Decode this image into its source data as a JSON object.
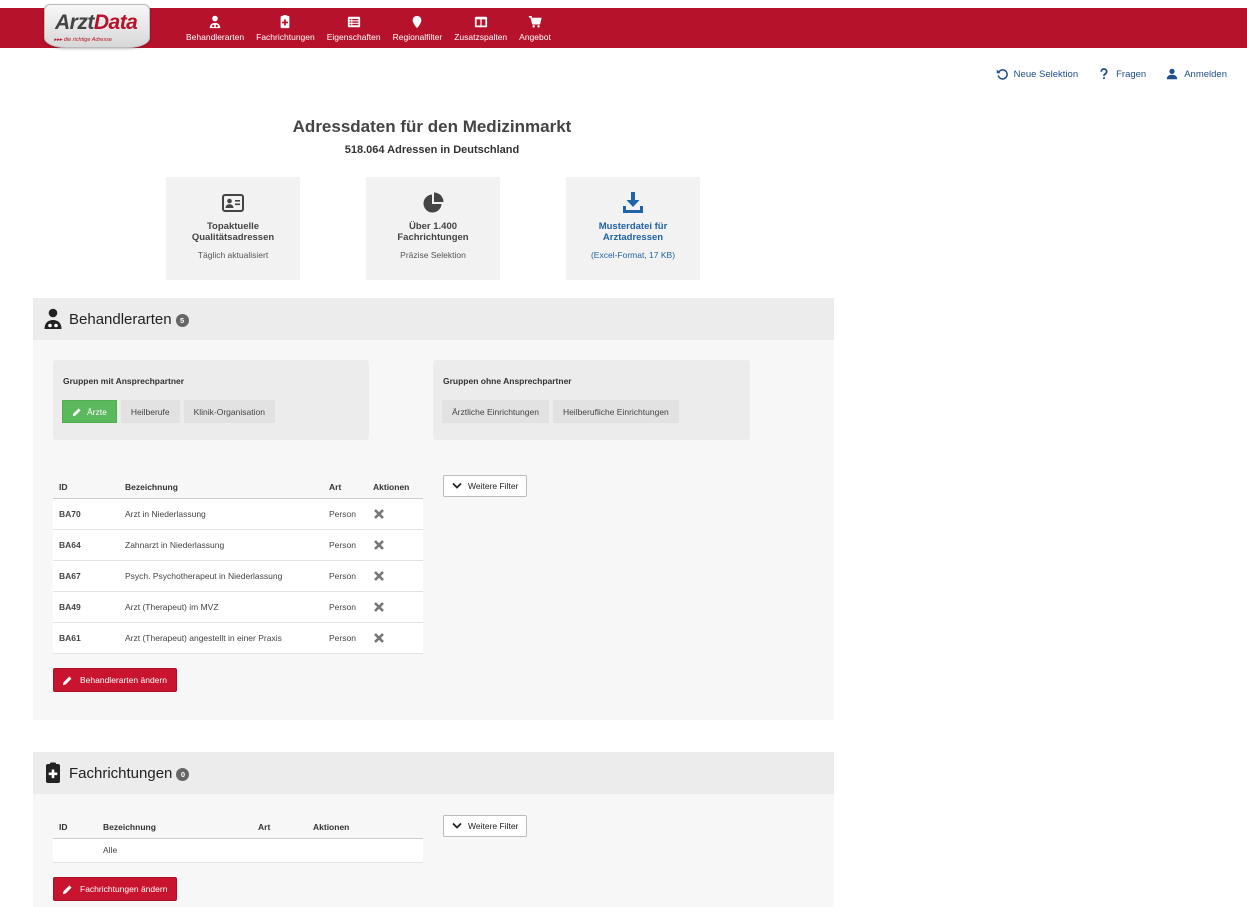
{
  "logo": {
    "word_a": "Arzt",
    "word_b": "Data",
    "tagline": "▸▸▸ die richtige Adresse"
  },
  "nav": [
    {
      "label": "Behandlerarten",
      "icon": "doctor-icon"
    },
    {
      "label": "Fachrichtungen",
      "icon": "medical-case-icon"
    },
    {
      "label": "Eigenschaften",
      "icon": "list-icon"
    },
    {
      "label": "Regionalfilter",
      "icon": "map-marker-icon"
    },
    {
      "label": "Zusatzspalten",
      "icon": "columns-icon"
    },
    {
      "label": "Angebot",
      "icon": "cart-icon"
    }
  ],
  "utility": {
    "new_selection": "Neue Selektion",
    "questions": "Fragen",
    "login": "Anmelden"
  },
  "hero": {
    "title": "Adressdaten für den Medizinmarkt",
    "subtitle": "518.064 Adressen in Deutschland"
  },
  "features": [
    {
      "title_l1": "Topaktuelle",
      "title_l2": "Qualitätsadressen",
      "sub": "Täglich aktualisiert",
      "icon": "id-card-icon"
    },
    {
      "title_l1": "Über 1.400",
      "title_l2": "Fachrichtungen",
      "sub": "Präzise Selektion",
      "icon": "pie-chart-icon"
    },
    {
      "title_l1": "Musterdatei für",
      "title_l2": "Arztadressen",
      "sub": "(Excel-Format, 17 KB)",
      "icon": "download-icon"
    }
  ],
  "behandlerarten": {
    "title": "Behandlerarten",
    "count": "5",
    "group_with": "Gruppen mit Ansprechpartner",
    "group_without": "Gruppen ohne Ansprechpartner",
    "chips_with": [
      "Ärzte",
      "Heilberufe",
      "Klinik-Organisation"
    ],
    "chips_without": [
      "Ärztliche Einrichtungen",
      "Heilberufliche Einrichtungen"
    ],
    "columns": [
      "ID",
      "Bezeichnung",
      "Art",
      "Aktionen"
    ],
    "rows": [
      {
        "id": "BA70",
        "name": "Arzt in Niederlassung",
        "type": "Person"
      },
      {
        "id": "BA64",
        "name": "Zahnarzt in Niederlassung",
        "type": "Person"
      },
      {
        "id": "BA67",
        "name": "Psych. Psychotherapeut in Niederlassung",
        "type": "Person"
      },
      {
        "id": "BA49",
        "name": "Arzt (Therapeut) im MVZ",
        "type": "Person"
      },
      {
        "id": "BA61",
        "name": "Arzt (Therapeut) angestellt in einer Praxis",
        "type": "Person"
      }
    ],
    "more_filters": "Weitere Filter",
    "change_button": "Behandlerarten ändern"
  },
  "fachrichtungen": {
    "title": "Fachrichtungen",
    "count": "0",
    "columns": [
      "ID",
      "Bezeichnung",
      "Art",
      "Aktionen"
    ],
    "rows": [
      {
        "id": "",
        "name": "Alle",
        "type": ""
      }
    ],
    "more_filters": "Weitere Filter",
    "change_button": "Fachrichtungen ändern"
  },
  "colors": {
    "brand_red": "#b7122b",
    "active_green": "#5cb85c",
    "link_blue": "#1e63a8"
  }
}
